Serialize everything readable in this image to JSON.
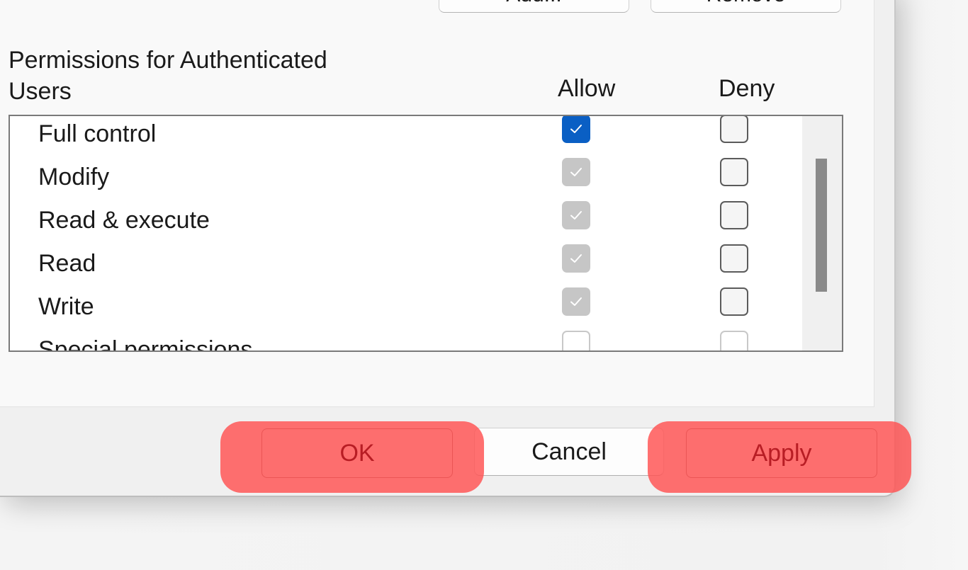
{
  "top_buttons": {
    "add_label": "Add...",
    "remove_label": "Remove"
  },
  "permissions": {
    "label": "Permissions for Authenticated Users",
    "allow_header": "Allow",
    "deny_header": "Deny",
    "rows": [
      {
        "label": "Full control",
        "allow": "checked",
        "deny": "unchecked"
      },
      {
        "label": "Modify",
        "allow": "checked-disabled",
        "deny": "unchecked"
      },
      {
        "label": "Read & execute",
        "allow": "checked-disabled",
        "deny": "unchecked"
      },
      {
        "label": "Read",
        "allow": "checked-disabled",
        "deny": "unchecked"
      },
      {
        "label": "Write",
        "allow": "checked-disabled",
        "deny": "unchecked"
      },
      {
        "label": "Special permissions",
        "allow": "unchecked",
        "deny": "unchecked"
      }
    ]
  },
  "footer": {
    "ok_label": "OK",
    "cancel_label": "Cancel",
    "apply_label": "Apply"
  },
  "colors": {
    "accent": "#0a5fc4",
    "highlight": "#ff5050"
  }
}
